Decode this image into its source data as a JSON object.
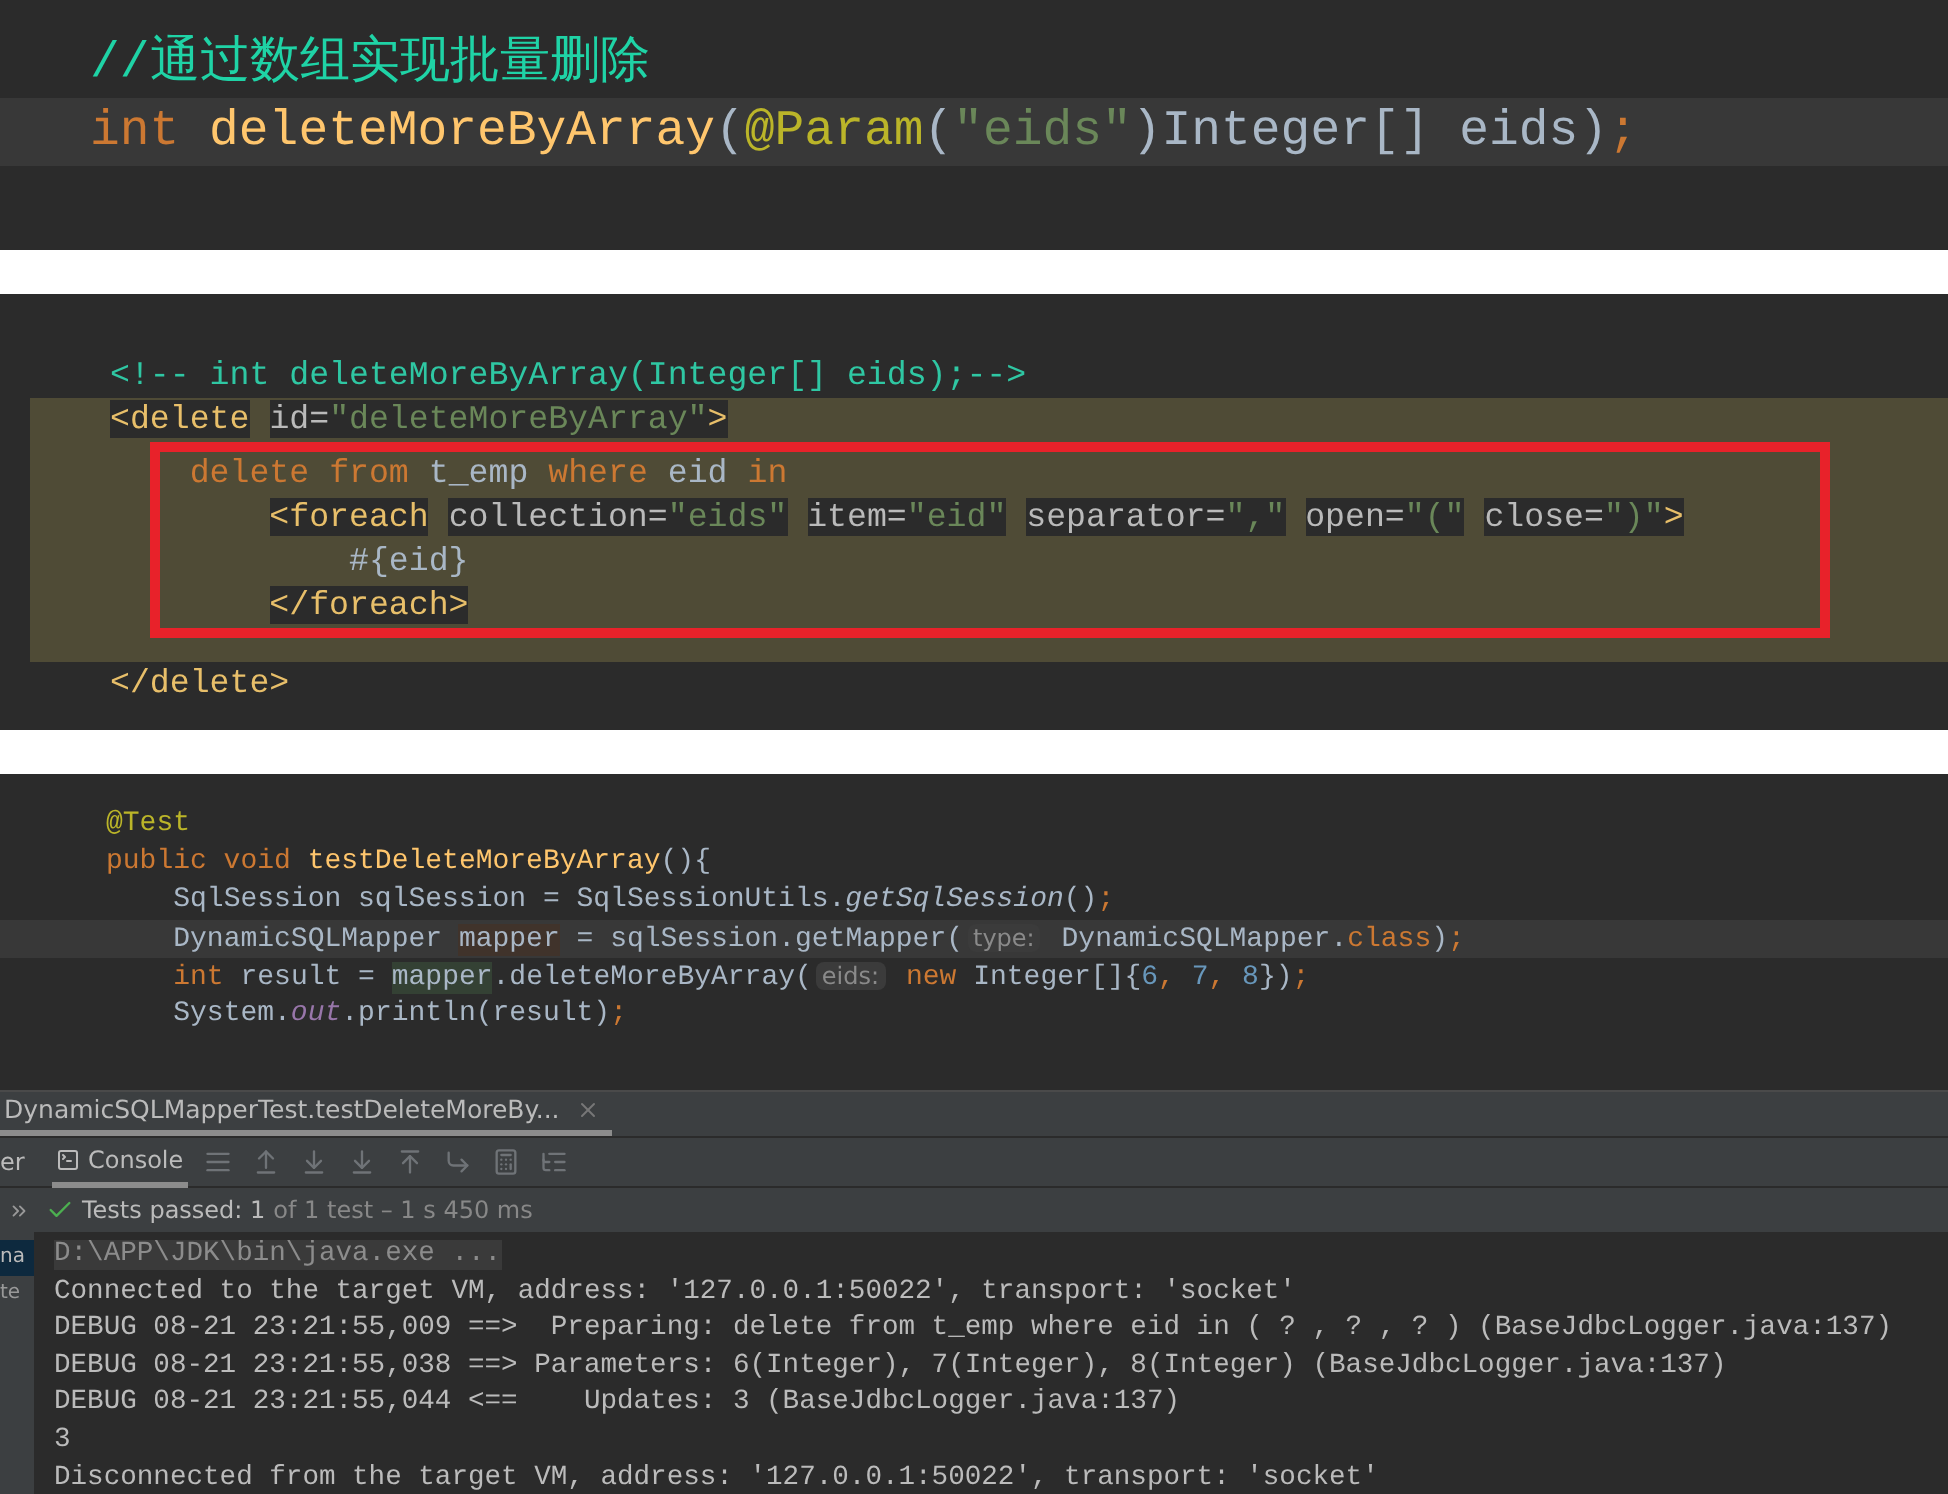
{
  "java_interface": {
    "lines": [
      {
        "current": false,
        "tokens": [
          {
            "text": "//通过数组实现批量删除",
            "kind": "doc_comment"
          }
        ]
      },
      {
        "current": true,
        "tokens": [
          {
            "text": "int",
            "kind": "keyword"
          },
          {
            "text": " deleteMoreByArray",
            "kind": "method"
          },
          {
            "text": "(",
            "kind": "plain"
          },
          {
            "text": "@Param",
            "kind": "annotation"
          },
          {
            "text": "(",
            "kind": "plain"
          },
          {
            "text": "\"eids\"",
            "kind": "string"
          },
          {
            "text": ")Integer[] eids)",
            "kind": "plain"
          },
          {
            "text": ";",
            "kind": "keyword"
          }
        ]
      }
    ]
  },
  "xml_mapper": {
    "lines": [
      {
        "highlight": false,
        "boxed": false,
        "tokens": [
          {
            "text": "<!-- int deleteMoreByArray(Integer[] eids);-->",
            "kind": "comment"
          }
        ]
      },
      {
        "highlight": true,
        "boxed": false,
        "tokens": [
          {
            "text": "<delete",
            "kind": "tag"
          },
          {
            "text": " id=",
            "kind": "attr"
          },
          {
            "text": "\"deleteMoreByArray\"",
            "kind": "string"
          },
          {
            "text": ">",
            "kind": "tag"
          }
        ]
      },
      {
        "highlight": true,
        "boxed": true,
        "tokens": [
          {
            "text": "    delete",
            "kind": "sql_keyword"
          },
          {
            "text": " from",
            "kind": "sql_keyword"
          },
          {
            "text": " t_emp ",
            "kind": "sql"
          },
          {
            "text": "where",
            "kind": "sql_keyword"
          },
          {
            "text": " eid ",
            "kind": "sql"
          },
          {
            "text": "in",
            "kind": "sql_keyword"
          }
        ]
      },
      {
        "highlight": true,
        "boxed": true,
        "tokens": [
          {
            "text": "        <foreach",
            "kind": "tag"
          },
          {
            "text": " collection=",
            "kind": "attr"
          },
          {
            "text": "\"eids\"",
            "kind": "string"
          },
          {
            "text": " item=",
            "kind": "attr"
          },
          {
            "text": "\"eid\"",
            "kind": "string"
          },
          {
            "text": " separator=",
            "kind": "attr"
          },
          {
            "text": "\",\"",
            "kind": "string"
          },
          {
            "text": " open=",
            "kind": "attr"
          },
          {
            "text": "\"(\"",
            "kind": "string"
          },
          {
            "text": " close=",
            "kind": "attr"
          },
          {
            "text": "\")\"",
            "kind": "string"
          },
          {
            "text": ">",
            "kind": "tag"
          }
        ]
      },
      {
        "highlight": true,
        "boxed": true,
        "tokens": [
          {
            "text": "            #{eid}",
            "kind": "sql"
          }
        ]
      },
      {
        "highlight": true,
        "boxed": true,
        "tokens": [
          {
            "text": "        </foreach>",
            "kind": "tag"
          }
        ]
      },
      {
        "highlight": false,
        "boxed": false,
        "tokens": [
          {
            "text": "</delete>",
            "kind": "tag"
          }
        ]
      }
    ]
  },
  "test_class": {
    "lines": [
      {
        "current": false,
        "tokens": [
          {
            "text": "@Test",
            "kind": "annotation"
          }
        ]
      },
      {
        "current": false,
        "tokens": [
          {
            "text": "public void ",
            "kind": "keyword"
          },
          {
            "text": "testDeleteMoreByArray",
            "kind": "method"
          },
          {
            "text": "(){",
            "kind": "plain"
          }
        ]
      },
      {
        "current": false,
        "tokens": [
          {
            "text": "    SqlSession sqlSession = SqlSessionUtils.",
            "kind": "plain"
          },
          {
            "text": "getSqlSession",
            "kind": "italic"
          },
          {
            "text": "()",
            "kind": "plain"
          },
          {
            "text": ";",
            "kind": "keyword"
          }
        ]
      },
      {
        "current": true,
        "tokens": [
          {
            "text": "    DynamicSQLMapper ",
            "kind": "plain"
          },
          {
            "text": "mapper",
            "kind": "write_usage"
          },
          {
            "text": " = sqlSession.getMapper(",
            "kind": "plain"
          },
          {
            "text": "type:",
            "kind": "hint"
          },
          {
            "text": " DynamicSQLMapper.",
            "kind": "plain"
          },
          {
            "text": "class",
            "kind": "keyword"
          },
          {
            "text": ")",
            "kind": "plain"
          },
          {
            "text": ";",
            "kind": "keyword"
          }
        ]
      },
      {
        "current": false,
        "tokens": [
          {
            "text": "    int",
            "kind": "keyword"
          },
          {
            "text": " result = ",
            "kind": "plain"
          },
          {
            "text": "mapper",
            "kind": "read_usage"
          },
          {
            "text": ".deleteMoreByArray(",
            "kind": "plain"
          },
          {
            "text": "eids:",
            "kind": "hint"
          },
          {
            "text": " new",
            "kind": "keyword"
          },
          {
            "text": " Integer[]{",
            "kind": "plain"
          },
          {
            "text": "6",
            "kind": "number"
          },
          {
            "text": ", ",
            "kind": "keyword"
          },
          {
            "text": "7",
            "kind": "number"
          },
          {
            "text": ", ",
            "kind": "keyword"
          },
          {
            "text": "8",
            "kind": "number"
          },
          {
            "text": "})",
            "kind": "plain"
          },
          {
            "text": ";",
            "kind": "keyword"
          }
        ]
      },
      {
        "current": false,
        "tokens": [
          {
            "text": "    System.",
            "kind": "plain"
          },
          {
            "text": "out",
            "kind": "static"
          },
          {
            "text": ".println(result)",
            "kind": "plain"
          },
          {
            "text": ";",
            "kind": "keyword"
          }
        ]
      }
    ]
  },
  "run_panel": {
    "tabs": [
      {
        "label": "DynamicSQLMapperTest.testDeleteMoreBy...",
        "selected": true
      }
    ],
    "toolbar_fragment": "er",
    "toolbar_tabs": [
      {
        "label": "Console",
        "selected": true
      }
    ],
    "status": {
      "passed": "Tests passed: 1",
      "detail": "of 1 test – 1 s 450 ms"
    },
    "side_items": [
      {
        "label": "na",
        "selected": true
      },
      {
        "label": "te",
        "selected": false
      }
    ],
    "output": [
      {
        "kind": "command",
        "text": "D:\\APP\\JDK\\bin\\java.exe ..."
      },
      {
        "kind": "plain",
        "text": "Connected to the target VM, address: '127.0.0.1:50022', transport: 'socket'"
      },
      {
        "kind": "plain",
        "text": "DEBUG 08-21 23:21:55,009 ==>  Preparing: delete from t_emp where eid in ( ? , ? , ? ) (BaseJdbcLogger.java:137)"
      },
      {
        "kind": "plain",
        "text": "DEBUG 08-21 23:21:55,038 ==> Parameters: 6(Integer), 7(Integer), 8(Integer) (BaseJdbcLogger.java:137)"
      },
      {
        "kind": "plain",
        "text": "DEBUG 08-21 23:21:55,044 <==    Updates: 3 (BaseJdbcLogger.java:137)"
      },
      {
        "kind": "plain",
        "text": "3"
      },
      {
        "kind": "plain",
        "text": "Disconnected from the target VM, address: '127.0.0.1:50022', transport: 'socket'"
      }
    ]
  }
}
